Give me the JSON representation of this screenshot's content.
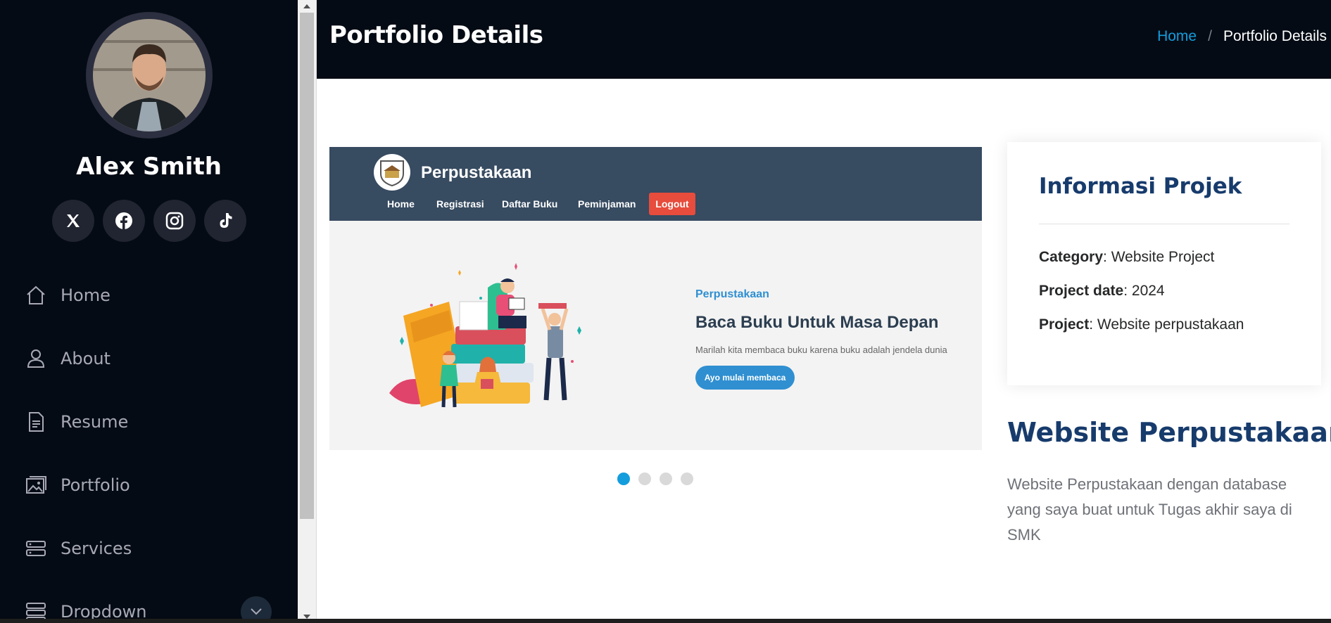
{
  "sidebar": {
    "profile_name": "Alex Smith",
    "socials": [
      {
        "icon": "x-twitter-icon"
      },
      {
        "icon": "facebook-icon"
      },
      {
        "icon": "instagram-icon"
      },
      {
        "icon": "tiktok-icon"
      }
    ],
    "nav": [
      {
        "label": "Home",
        "icon": "home-icon"
      },
      {
        "label": "About",
        "icon": "person-icon"
      },
      {
        "label": "Resume",
        "icon": "file-icon"
      },
      {
        "label": "Portfolio",
        "icon": "images-icon"
      },
      {
        "label": "Services",
        "icon": "server-icon"
      },
      {
        "label": "Dropdown",
        "icon": "menu-icon"
      }
    ]
  },
  "header": {
    "title": "Portfolio Details",
    "breadcrumb": {
      "home": "Home",
      "separator": "/",
      "current": "Portfolio Details"
    }
  },
  "slide": {
    "brand": "Perpustakaan",
    "nav_links": [
      "Home",
      "Registrasi",
      "Daftar Buku",
      "Peminjaman"
    ],
    "logout": "Logout",
    "tag": "Perpustakaan",
    "heading": "Baca Buku Untuk Masa Depan",
    "description": "Marilah kita membaca buku karena buku adalah jendela dunia",
    "cta": "Ayo mulai membaca",
    "slide_count": 4,
    "active_slide": 1
  },
  "info": {
    "title": "Informasi Projek",
    "category_label": "Category",
    "category_value": ": Website Project",
    "date_label": "Project date",
    "date_value": ": 2024",
    "project_label": "Project",
    "project_value": ": Website perpustakaan"
  },
  "project": {
    "title": "Website Perpustakaan",
    "description": "Website Perpustakaan dengan database yang saya buat untuk Tugas akhir saya di SMK"
  },
  "colors": {
    "accent": "#149ddd",
    "sidebar_bg": "#040b14",
    "heading": "#173b6c"
  }
}
